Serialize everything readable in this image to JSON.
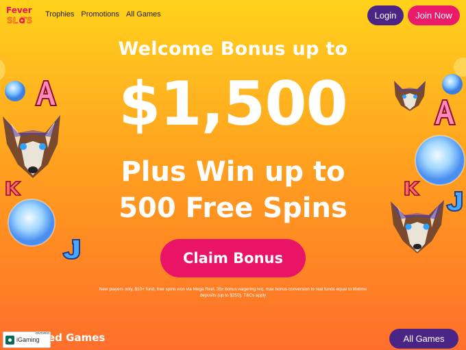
{
  "brand": {
    "logo_text_top": "Fever",
    "logo_text_bottom": "SL TS"
  },
  "nav": {
    "items": [
      {
        "label": "Trophies"
      },
      {
        "label": "Promotions"
      },
      {
        "label": "All Games"
      }
    ]
  },
  "auth": {
    "login_label": "Login",
    "join_label": "Join Now"
  },
  "hero": {
    "line1": "Welcome Bonus up to",
    "amount": "$1,500",
    "line3": "Plus Win up to",
    "line4": "500 Free Spins",
    "cta_label": "Claim Bonus",
    "terms": "New players only, $10+ fund, free spins won via Mega Reel, 35x bonus wagering req, max bonus conversion to real funds equal to lifetime deposits (up to $250), T&Cs apply"
  },
  "featured": {
    "title_visible": "ed Games",
    "all_games_label": "All Games"
  },
  "badge": {
    "name": "iGaming",
    "region": "ONTARIO"
  },
  "decorations": {
    "symbols": [
      "A",
      "K",
      "J",
      "A",
      "K",
      "J"
    ],
    "icons": [
      "wolf-icon",
      "moon-orb-icon",
      "card-letter-icon"
    ]
  },
  "colors": {
    "login_bg": "#4b2586",
    "join_bg": "#ec1a6b",
    "claim_bg": "#ea1466",
    "bg_top": "#ffd21a",
    "bg_bottom": "#ff6f2c"
  }
}
